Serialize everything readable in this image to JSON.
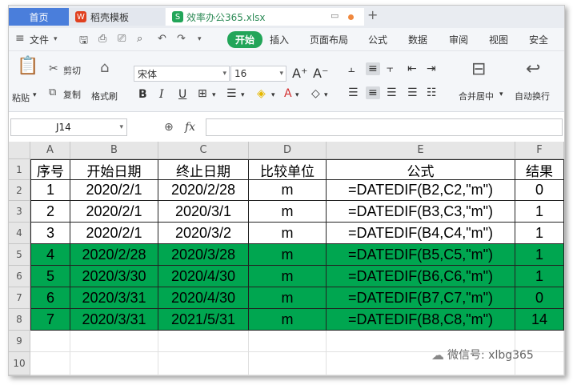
{
  "tabs": {
    "home": "首页",
    "template": "稻壳模板",
    "document": "效率办公365.xlsx",
    "add": "+"
  },
  "menu": {
    "file": "文件",
    "start": "开始",
    "insert": "插入",
    "page_layout": "页面布局",
    "formula": "公式",
    "data": "数据",
    "review": "审阅",
    "view": "视图",
    "security": "安全"
  },
  "ribbon": {
    "paste": "粘贴",
    "cut": "剪切",
    "copy": "复制",
    "format_painter": "格式刷",
    "font_name": "宋体",
    "font_size": "16",
    "merge_center": "合并居中",
    "wrap_text": "自动换行"
  },
  "formula_bar": {
    "cell_ref": "J14",
    "fx": "fx",
    "content": ""
  },
  "columns": [
    "A",
    "B",
    "C",
    "D",
    "E",
    "F"
  ],
  "rows": [
    "1",
    "2",
    "3",
    "4",
    "5",
    "6",
    "7",
    "8",
    "9",
    "10"
  ],
  "header": [
    "序号",
    "开始日期",
    "终止日期",
    "比较单位",
    "公式",
    "结果"
  ],
  "table": [
    {
      "no": "1",
      "start": "2020/2/1",
      "end": "2020/2/28",
      "unit": "m",
      "formula": "=DATEDIF(B2,C2,\"m\")",
      "result": "0",
      "highlight": false
    },
    {
      "no": "2",
      "start": "2020/2/1",
      "end": "2020/3/1",
      "unit": "m",
      "formula": "=DATEDIF(B3,C3,\"m\")",
      "result": "1",
      "highlight": false
    },
    {
      "no": "3",
      "start": "2020/2/1",
      "end": "2020/3/2",
      "unit": "m",
      "formula": "=DATEDIF(B4,C4,\"m\")",
      "result": "1",
      "highlight": false
    },
    {
      "no": "4",
      "start": "2020/2/28",
      "end": "2020/3/28",
      "unit": "m",
      "formula": "=DATEDIF(B5,C5,\"m\")",
      "result": "1",
      "highlight": true
    },
    {
      "no": "5",
      "start": "2020/3/30",
      "end": "2020/4/30",
      "unit": "m",
      "formula": "=DATEDIF(B6,C6,\"m\")",
      "result": "1",
      "highlight": true
    },
    {
      "no": "6",
      "start": "2020/3/31",
      "end": "2020/4/30",
      "unit": "m",
      "formula": "=DATEDIF(B7,C7,\"m\")",
      "result": "0",
      "highlight": true
    },
    {
      "no": "7",
      "start": "2020/3/31",
      "end": "2021/5/31",
      "unit": "m",
      "formula": "=DATEDIF(B8,C8,\"m\")",
      "result": "14",
      "highlight": true
    }
  ],
  "colors": {
    "highlight": "#00a650",
    "accent": "#22a559",
    "home_tab": "#4a7edb"
  },
  "watermark": "微信号: xlbg365"
}
